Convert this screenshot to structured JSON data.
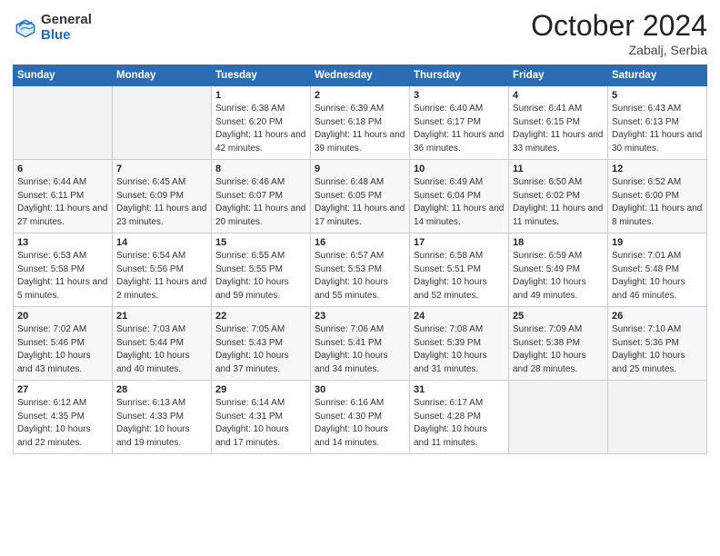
{
  "header": {
    "logo_general": "General",
    "logo_blue": "Blue",
    "month_title": "October 2024",
    "location": "Zabalj, Serbia"
  },
  "weekdays": [
    "Sunday",
    "Monday",
    "Tuesday",
    "Wednesday",
    "Thursday",
    "Friday",
    "Saturday"
  ],
  "weeks": [
    [
      {
        "day": "",
        "sunrise": "",
        "sunset": "",
        "daylight": ""
      },
      {
        "day": "",
        "sunrise": "",
        "sunset": "",
        "daylight": ""
      },
      {
        "day": "1",
        "sunrise": "Sunrise: 6:38 AM",
        "sunset": "Sunset: 6:20 PM",
        "daylight": "Daylight: 11 hours and 42 minutes."
      },
      {
        "day": "2",
        "sunrise": "Sunrise: 6:39 AM",
        "sunset": "Sunset: 6:18 PM",
        "daylight": "Daylight: 11 hours and 39 minutes."
      },
      {
        "day": "3",
        "sunrise": "Sunrise: 6:40 AM",
        "sunset": "Sunset: 6:17 PM",
        "daylight": "Daylight: 11 hours and 36 minutes."
      },
      {
        "day": "4",
        "sunrise": "Sunrise: 6:41 AM",
        "sunset": "Sunset: 6:15 PM",
        "daylight": "Daylight: 11 hours and 33 minutes."
      },
      {
        "day": "5",
        "sunrise": "Sunrise: 6:43 AM",
        "sunset": "Sunset: 6:13 PM",
        "daylight": "Daylight: 11 hours and 30 minutes."
      }
    ],
    [
      {
        "day": "6",
        "sunrise": "Sunrise: 6:44 AM",
        "sunset": "Sunset: 6:11 PM",
        "daylight": "Daylight: 11 hours and 27 minutes."
      },
      {
        "day": "7",
        "sunrise": "Sunrise: 6:45 AM",
        "sunset": "Sunset: 6:09 PM",
        "daylight": "Daylight: 11 hours and 23 minutes."
      },
      {
        "day": "8",
        "sunrise": "Sunrise: 6:46 AM",
        "sunset": "Sunset: 6:07 PM",
        "daylight": "Daylight: 11 hours and 20 minutes."
      },
      {
        "day": "9",
        "sunrise": "Sunrise: 6:48 AM",
        "sunset": "Sunset: 6:05 PM",
        "daylight": "Daylight: 11 hours and 17 minutes."
      },
      {
        "day": "10",
        "sunrise": "Sunrise: 6:49 AM",
        "sunset": "Sunset: 6:04 PM",
        "daylight": "Daylight: 11 hours and 14 minutes."
      },
      {
        "day": "11",
        "sunrise": "Sunrise: 6:50 AM",
        "sunset": "Sunset: 6:02 PM",
        "daylight": "Daylight: 11 hours and 11 minutes."
      },
      {
        "day": "12",
        "sunrise": "Sunrise: 6:52 AM",
        "sunset": "Sunset: 6:00 PM",
        "daylight": "Daylight: 11 hours and 8 minutes."
      }
    ],
    [
      {
        "day": "13",
        "sunrise": "Sunrise: 6:53 AM",
        "sunset": "Sunset: 5:58 PM",
        "daylight": "Daylight: 11 hours and 5 minutes."
      },
      {
        "day": "14",
        "sunrise": "Sunrise: 6:54 AM",
        "sunset": "Sunset: 5:56 PM",
        "daylight": "Daylight: 11 hours and 2 minutes."
      },
      {
        "day": "15",
        "sunrise": "Sunrise: 6:55 AM",
        "sunset": "Sunset: 5:55 PM",
        "daylight": "Daylight: 10 hours and 59 minutes."
      },
      {
        "day": "16",
        "sunrise": "Sunrise: 6:57 AM",
        "sunset": "Sunset: 5:53 PM",
        "daylight": "Daylight: 10 hours and 55 minutes."
      },
      {
        "day": "17",
        "sunrise": "Sunrise: 6:58 AM",
        "sunset": "Sunset: 5:51 PM",
        "daylight": "Daylight: 10 hours and 52 minutes."
      },
      {
        "day": "18",
        "sunrise": "Sunrise: 6:59 AM",
        "sunset": "Sunset: 5:49 PM",
        "daylight": "Daylight: 10 hours and 49 minutes."
      },
      {
        "day": "19",
        "sunrise": "Sunrise: 7:01 AM",
        "sunset": "Sunset: 5:48 PM",
        "daylight": "Daylight: 10 hours and 46 minutes."
      }
    ],
    [
      {
        "day": "20",
        "sunrise": "Sunrise: 7:02 AM",
        "sunset": "Sunset: 5:46 PM",
        "daylight": "Daylight: 10 hours and 43 minutes."
      },
      {
        "day": "21",
        "sunrise": "Sunrise: 7:03 AM",
        "sunset": "Sunset: 5:44 PM",
        "daylight": "Daylight: 10 hours and 40 minutes."
      },
      {
        "day": "22",
        "sunrise": "Sunrise: 7:05 AM",
        "sunset": "Sunset: 5:43 PM",
        "daylight": "Daylight: 10 hours and 37 minutes."
      },
      {
        "day": "23",
        "sunrise": "Sunrise: 7:06 AM",
        "sunset": "Sunset: 5:41 PM",
        "daylight": "Daylight: 10 hours and 34 minutes."
      },
      {
        "day": "24",
        "sunrise": "Sunrise: 7:08 AM",
        "sunset": "Sunset: 5:39 PM",
        "daylight": "Daylight: 10 hours and 31 minutes."
      },
      {
        "day": "25",
        "sunrise": "Sunrise: 7:09 AM",
        "sunset": "Sunset: 5:38 PM",
        "daylight": "Daylight: 10 hours and 28 minutes."
      },
      {
        "day": "26",
        "sunrise": "Sunrise: 7:10 AM",
        "sunset": "Sunset: 5:36 PM",
        "daylight": "Daylight: 10 hours and 25 minutes."
      }
    ],
    [
      {
        "day": "27",
        "sunrise": "Sunrise: 6:12 AM",
        "sunset": "Sunset: 4:35 PM",
        "daylight": "Daylight: 10 hours and 22 minutes."
      },
      {
        "day": "28",
        "sunrise": "Sunrise: 6:13 AM",
        "sunset": "Sunset: 4:33 PM",
        "daylight": "Daylight: 10 hours and 19 minutes."
      },
      {
        "day": "29",
        "sunrise": "Sunrise: 6:14 AM",
        "sunset": "Sunset: 4:31 PM",
        "daylight": "Daylight: 10 hours and 17 minutes."
      },
      {
        "day": "30",
        "sunrise": "Sunrise: 6:16 AM",
        "sunset": "Sunset: 4:30 PM",
        "daylight": "Daylight: 10 hours and 14 minutes."
      },
      {
        "day": "31",
        "sunrise": "Sunrise: 6:17 AM",
        "sunset": "Sunset: 4:28 PM",
        "daylight": "Daylight: 10 hours and 11 minutes."
      },
      {
        "day": "",
        "sunrise": "",
        "sunset": "",
        "daylight": ""
      },
      {
        "day": "",
        "sunrise": "",
        "sunset": "",
        "daylight": ""
      }
    ]
  ]
}
